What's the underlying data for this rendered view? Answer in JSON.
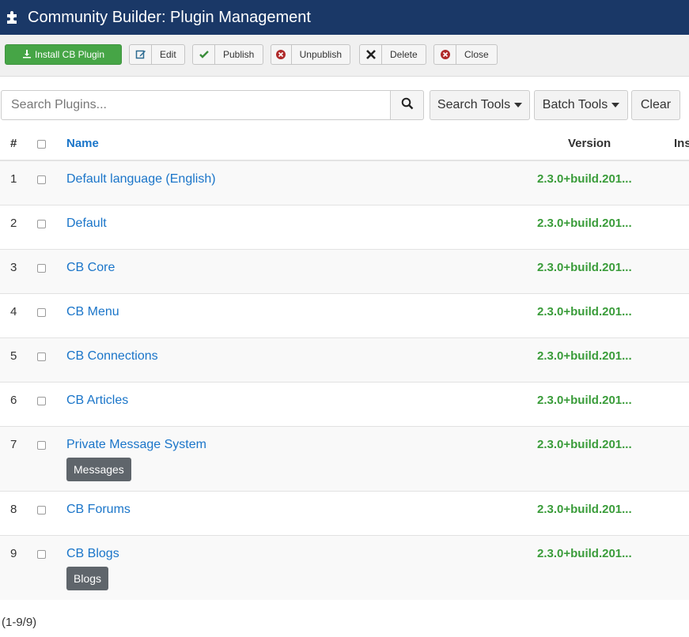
{
  "header": {
    "title": "Community Builder: Plugin Management",
    "icon": "puzzle-icon"
  },
  "toolbar": {
    "install_label": "Install CB Plugin",
    "edit_label": "Edit",
    "publish_label": "Publish",
    "unpublish_label": "Unpublish",
    "delete_label": "Delete",
    "close_label": "Close"
  },
  "search": {
    "placeholder": "Search Plugins...",
    "search_tools_label": "Search Tools",
    "batch_tools_label": "Batch Tools",
    "clear_label": "Clear"
  },
  "table": {
    "columns": {
      "num": "#",
      "name": "Name",
      "version": "Version",
      "installed": "Ins"
    },
    "rows": [
      {
        "num": "1",
        "name": "Default language (English)",
        "version": "2.3.0+build.201...",
        "tag": ""
      },
      {
        "num": "2",
        "name": "Default",
        "version": "2.3.0+build.201...",
        "tag": ""
      },
      {
        "num": "3",
        "name": "CB Core",
        "version": "2.3.0+build.201...",
        "tag": ""
      },
      {
        "num": "4",
        "name": "CB Menu",
        "version": "2.3.0+build.201...",
        "tag": ""
      },
      {
        "num": "5",
        "name": "CB Connections",
        "version": "2.3.0+build.201...",
        "tag": ""
      },
      {
        "num": "6",
        "name": "CB Articles",
        "version": "2.3.0+build.201...",
        "tag": ""
      },
      {
        "num": "7",
        "name": "Private Message System",
        "version": "2.3.0+build.201...",
        "tag": "Messages"
      },
      {
        "num": "8",
        "name": "CB Forums",
        "version": "2.3.0+build.201...",
        "tag": ""
      },
      {
        "num": "9",
        "name": "CB Blogs",
        "version": "2.3.0+build.201...",
        "tag": "Blogs"
      }
    ]
  },
  "pagination": {
    "summary": "(1-9/9)"
  },
  "colors": {
    "header_bg": "#1a3867",
    "link": "#1a75c9",
    "version_green": "#3a9c3a",
    "install_green": "#46a546"
  }
}
